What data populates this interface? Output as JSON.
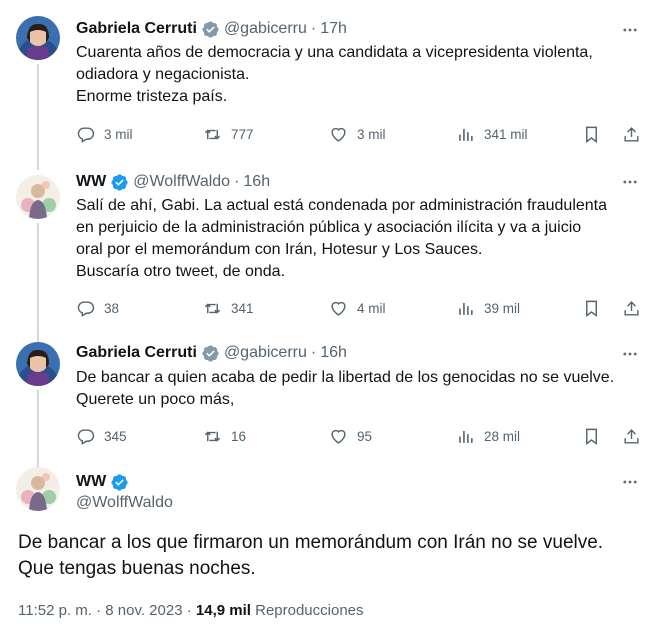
{
  "tweets": [
    {
      "name": "Gabriela Cerruti",
      "handle": "@gabicerru",
      "sep": "·",
      "time": "17h",
      "lines": [
        "Cuarenta años de democracia y una candidata a vicepresidenta violenta,",
        "odiadora y negacionista.",
        "Enorme tristeza país."
      ],
      "replies": "3 mil",
      "reposts": "777",
      "likes": "3 mil",
      "views": "341 mil"
    },
    {
      "name": "WW",
      "handle": "@WolffWaldo",
      "sep": "·",
      "time": "16h",
      "lines": [
        "Salí de ahí, Gabi. La actual está condenada por administración fraudulenta",
        "en perjuicio de la administración pública y asociación ilícita y va a juicio",
        "oral por el memorándum con Irán, Hotesur y Los Sauces.",
        "Buscaría otro tweet, de onda."
      ],
      "replies": "38",
      "reposts": "341",
      "likes": "4 mil",
      "views": "39 mil"
    },
    {
      "name": "Gabriela Cerruti",
      "handle": "@gabicerru",
      "sep": "·",
      "time": "16h",
      "lines": [
        "De bancar a quien acaba de pedir la libertad de los genocidas no se vuelve.",
        "Querete un poco más,"
      ],
      "replies": "345",
      "reposts": "16",
      "likes": "95",
      "views": "28 mil"
    }
  ],
  "main": {
    "name": "WW",
    "handle": "@WolffWaldo",
    "lines": [
      "De bancar a los que firmaron un memorándum con Irán no se vuelve.",
      "Que tengas buenas noches."
    ],
    "timestamp": "11:52 p. m. · 8 nov. 2023 · ",
    "views_count": "14,9 mil",
    "views_label": " Reproducciones"
  },
  "colors": {
    "verified": "#1d9bf0",
    "secondary_text": "#536471",
    "primary_text": "#0f1419",
    "thread_line": "#cfd9de"
  },
  "icons": [
    "more-icon",
    "reply-icon",
    "repost-icon",
    "like-icon",
    "views-icon",
    "bookmark-icon",
    "share-icon",
    "verified-badge-icon"
  ]
}
